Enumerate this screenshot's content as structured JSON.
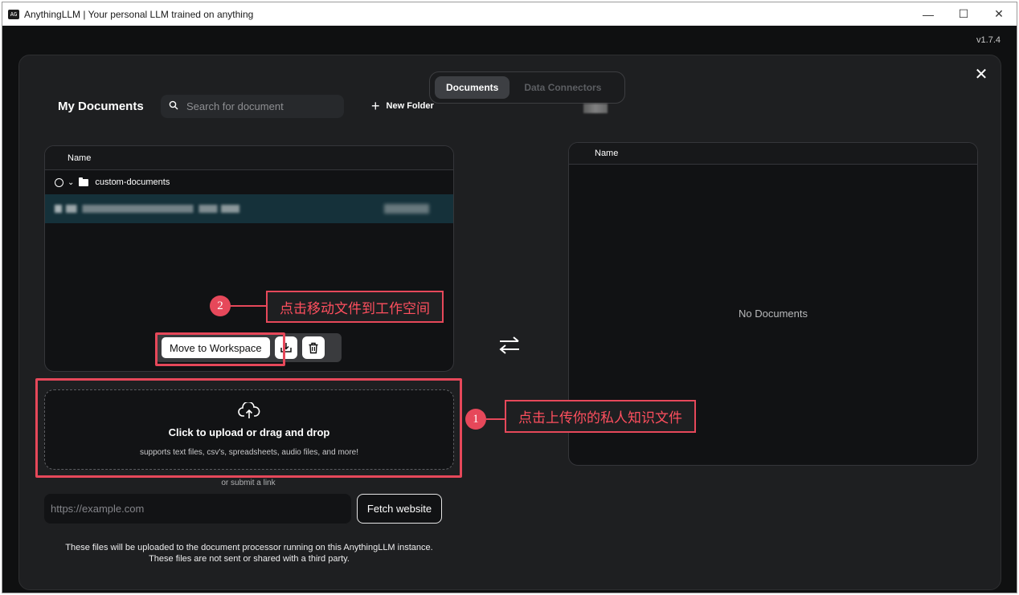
{
  "window": {
    "app_icon_text": "AG",
    "title": "AnythingLLM | Your personal LLM trained on anything",
    "controls": {
      "minimize": "—",
      "maximize": "☐",
      "close": "✕"
    }
  },
  "version": "v1.7.4",
  "tabs": [
    {
      "label": "Documents",
      "active": true
    },
    {
      "label": "Data Connectors",
      "active": false
    }
  ],
  "documents": {
    "title": "My Documents",
    "search_placeholder": "Search for document",
    "new_folder_label": "New Folder",
    "column_name": "Name",
    "folder_name": "custom-documents",
    "actions": {
      "move_label": "Move to Workspace"
    }
  },
  "upload": {
    "title": "Click to upload or drag and drop",
    "subtitle": "supports text files, csv's, spreadsheets, audio files, and more!",
    "or_link": "or submit a link",
    "url_placeholder": "https://example.com",
    "fetch_label": "Fetch website",
    "footer_line1": "These files will be uploaded to the document processor running on this AnythingLLM instance.",
    "footer_line2": "These files are not sent or shared with a third party."
  },
  "workspace": {
    "column_name": "Name",
    "empty_text": "No Documents"
  },
  "annotations": [
    {
      "number": "1",
      "text": "点击上传你的私人知识文件"
    },
    {
      "number": "2",
      "text": "点击移动文件到工作空间"
    }
  ],
  "colors": {
    "highlight": "#e6485a",
    "modal_bg": "#1e1f21",
    "selected_row": "#15313a"
  }
}
